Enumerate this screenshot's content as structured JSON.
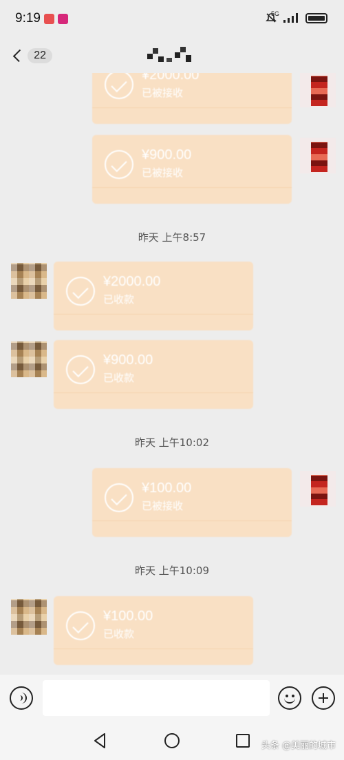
{
  "status_bar": {
    "time": "9:19",
    "network": "5G"
  },
  "header": {
    "unread_count": "22"
  },
  "timestamps": [
    "昨天 上午8:57",
    "昨天 上午10:02",
    "昨天 上午10:09"
  ],
  "messages": [
    {
      "side": "right",
      "amount": "¥2000.00",
      "status": "已被接收"
    },
    {
      "side": "right",
      "amount": "¥900.00",
      "status": "已被接收"
    },
    {
      "side": "left",
      "amount": "¥2000.00",
      "status": "已收款"
    },
    {
      "side": "left",
      "amount": "¥900.00",
      "status": "已收款"
    },
    {
      "side": "right",
      "amount": "¥100.00",
      "status": "已被接收"
    },
    {
      "side": "left",
      "amount": "¥100.00",
      "status": "已收款"
    }
  ],
  "input_bar": {
    "placeholder": ""
  },
  "colors": {
    "transfer_bubble": "#f9e0c4",
    "chat_background": "#ededed"
  },
  "icons": [
    "back-chevron-icon",
    "voice-icon",
    "emoji-icon",
    "plus-icon",
    "nav-back-icon",
    "nav-home-icon",
    "nav-recent-icon"
  ],
  "watermark": "头条 @美丽的城市"
}
